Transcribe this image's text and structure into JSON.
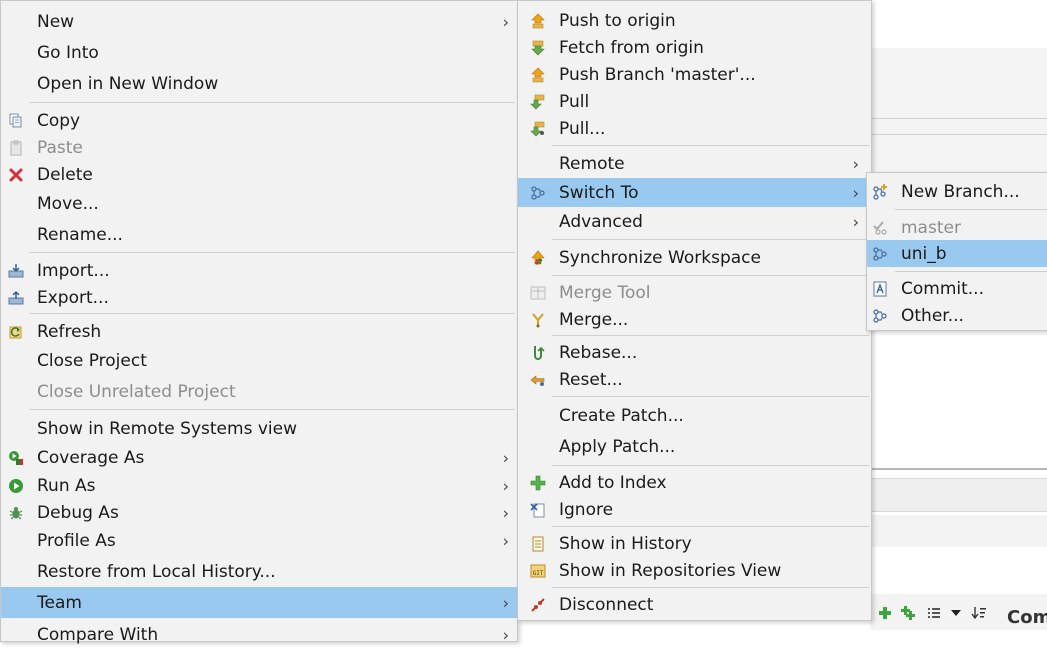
{
  "menu_main": {
    "items": [
      {
        "label": "New",
        "arrow": "›"
      },
      {
        "label": "Go Into"
      },
      {
        "label": "Open in New Window"
      },
      {
        "label": "Copy"
      },
      {
        "label": "Paste"
      },
      {
        "label": "Delete"
      },
      {
        "label": "Move..."
      },
      {
        "label": "Rename..."
      },
      {
        "label": "Import..."
      },
      {
        "label": "Export..."
      },
      {
        "label": "Refresh"
      },
      {
        "label": "Close Project"
      },
      {
        "label": "Close Unrelated Project"
      },
      {
        "label": "Show in Remote Systems view"
      },
      {
        "label": "Coverage As",
        "arrow": "›"
      },
      {
        "label": "Run As",
        "arrow": "›"
      },
      {
        "label": "Debug As",
        "arrow": "›"
      },
      {
        "label": "Profile As",
        "arrow": "›"
      },
      {
        "label": "Restore from Local History..."
      },
      {
        "label": "Team",
        "arrow": "›"
      },
      {
        "label": "Compare With",
        "arrow": "›"
      }
    ]
  },
  "menu_team": {
    "items": [
      {
        "label": "Push to origin"
      },
      {
        "label": "Fetch from origin"
      },
      {
        "label": "Push Branch 'master'..."
      },
      {
        "label": "Pull"
      },
      {
        "label": "Pull..."
      },
      {
        "label": "Remote",
        "arrow": "›"
      },
      {
        "label": "Switch To",
        "arrow": "›"
      },
      {
        "label": "Advanced",
        "arrow": "›"
      },
      {
        "label": "Synchronize Workspace"
      },
      {
        "label": "Merge Tool"
      },
      {
        "label": "Merge..."
      },
      {
        "label": "Rebase..."
      },
      {
        "label": "Reset..."
      },
      {
        "label": "Create Patch..."
      },
      {
        "label": "Apply Patch..."
      },
      {
        "label": "Add to Index"
      },
      {
        "label": "Ignore"
      },
      {
        "label": "Show in History"
      },
      {
        "label": "Show in Repositories View"
      },
      {
        "label": "Disconnect"
      }
    ]
  },
  "menu_switch": {
    "items": [
      {
        "label": "New Branch..."
      },
      {
        "label": "master"
      },
      {
        "label": "uni_b"
      },
      {
        "label": "Commit..."
      },
      {
        "label": "Other..."
      }
    ]
  },
  "background": {
    "bottom_right_text": "Com"
  },
  "colors": {
    "selection": "#99c9ef",
    "menu_bg": "#f2f2f2",
    "disabled": "#8d8d8d"
  }
}
